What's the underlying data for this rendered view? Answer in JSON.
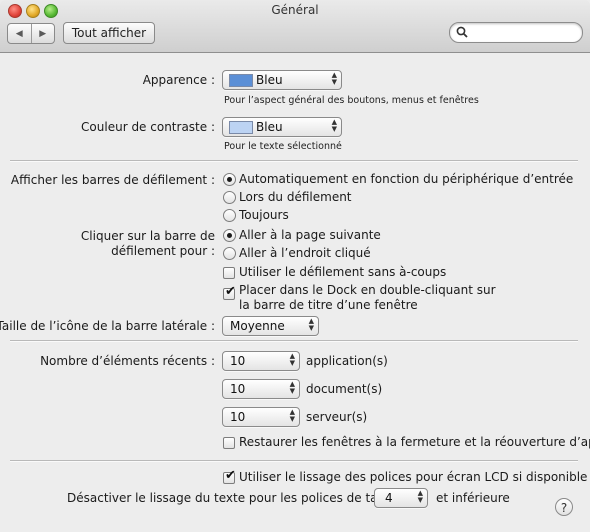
{
  "window": {
    "title": "Général"
  },
  "toolbar": {
    "back_glyph": "◀",
    "forward_glyph": "▶",
    "show_all_label": "Tout afficher",
    "search_placeholder": ""
  },
  "appearance": {
    "label": "Apparence :",
    "value": "Bleu",
    "note": "Pour l’aspect général des boutons, menus et fenêtres",
    "swatch_color": "#5b8fd6"
  },
  "highlight": {
    "label": "Couleur de contraste :",
    "value": "Bleu",
    "note": "Pour le texte sélectionné",
    "swatch_color": "#bcd3f3"
  },
  "scrollbars": {
    "label": "Afficher les barres de défilement :",
    "options": [
      {
        "label": "Automatiquement en fonction du périphérique d’entrée",
        "selected": true
      },
      {
        "label": "Lors du défilement",
        "selected": false
      },
      {
        "label": "Toujours",
        "selected": false
      }
    ]
  },
  "click_scrollbar": {
    "label_line1": "Cliquer sur la barre de",
    "label_line2": "défilement pour :",
    "options": [
      {
        "label": "Aller à la page suivante",
        "selected": true
      },
      {
        "label": "Aller à l’endroit cliqué",
        "selected": false
      }
    ]
  },
  "smooth_scroll": {
    "label": "Utiliser le défilement sans à-coups",
    "checked": false
  },
  "dock_double_click": {
    "label_line1": "Placer dans le Dock en double-cliquant sur",
    "label_line2": "la barre de titre d’une fenêtre",
    "checked": true
  },
  "sidebar_icon": {
    "label": "Taille de l’icône de la barre latérale :",
    "value": "Moyenne"
  },
  "recent_items": {
    "label": "Nombre d’éléments récents :",
    "rows": [
      {
        "value": "10",
        "unit": "application(s)"
      },
      {
        "value": "10",
        "unit": "document(s)"
      },
      {
        "value": "10",
        "unit": "serveur(s)"
      }
    ]
  },
  "restore_windows": {
    "label": "Restaurer les fenêtres à la fermeture et la réouverture d’apps",
    "checked": false
  },
  "lcd_smoothing": {
    "label": "Utiliser le lissage des polices pour écran LCD si disponible",
    "checked": true
  },
  "font_smoothing": {
    "label": "Désactiver le lissage du texte pour les polices de taille",
    "value": "4",
    "suffix": "et inférieure"
  },
  "help": {
    "glyph": "?"
  },
  "icons": {
    "search": "magnifier-icon",
    "popup_arrows": "up-down-arrows-icon",
    "checkmark": "checkmark-icon"
  }
}
